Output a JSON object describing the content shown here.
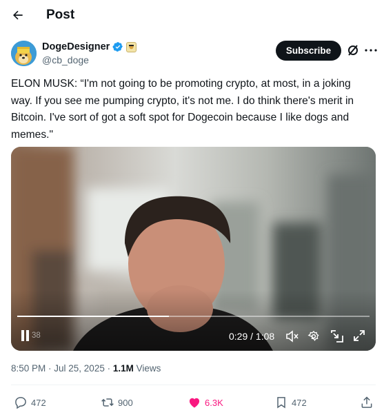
{
  "header": {
    "title": "Post",
    "back_icon": "arrow-left-icon"
  },
  "post": {
    "author": {
      "name": "DogeDesigner",
      "handle": "@cb_doge",
      "verified_icon": "verified-badge-icon",
      "affiliate_icon": "affiliate-badge-icon",
      "avatar_icon": "doge-avatar"
    },
    "subscribe_label": "Subscribe",
    "text": "ELON MUSK: “I'm not going to be promoting crypto, at most, in a joking way. If you see me pumping crypto, it's not me. I do think there's merit in Bitcoin. I've sort of got a soft spot for Dogecoin because I like dogs and memes.\"",
    "video": {
      "elapsed_ghost": "38",
      "time_readout": "0:29 / 1:08",
      "progress_fraction": 0.43
    },
    "meta": {
      "time": "8:50 PM · Jul 25, 2025 · ",
      "views_count": "1.1M",
      "views_label": " Views"
    },
    "actions": {
      "replies": "472",
      "reposts": "900",
      "likes": "6.3K",
      "bookmarks": "472"
    }
  },
  "colors": {
    "accent": "#1d9bf0",
    "like": "#f91880",
    "muted": "#536471",
    "text": "#0f1419"
  }
}
